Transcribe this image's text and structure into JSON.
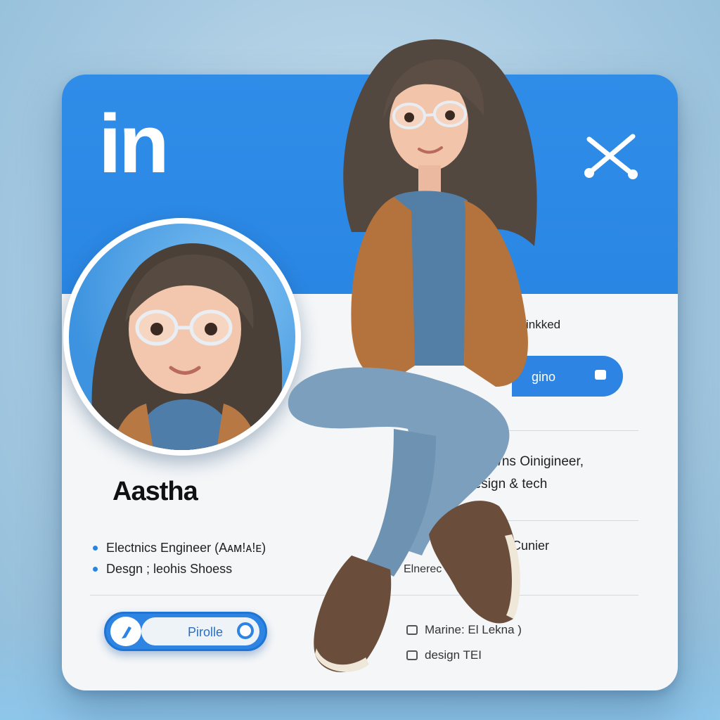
{
  "header": {
    "logo_text": "in",
    "accent_color": "#2f8de8"
  },
  "profile": {
    "name": "Aastha",
    "bullets": [
      "Electnics Engineer (Aᴀᴍ!ᴀ!ᴇ)",
      "Desgn ; leohis Shoess"
    ],
    "profile_button_label": "Pirolle"
  },
  "right_panel": {
    "linked_text": "inkked",
    "connect_button_label": "gino",
    "line1": "lelecti/ns Oinigineer,",
    "line2": "Design & tech",
    "line3": "Cunier",
    "line4": "Elnerec",
    "footer_items": [
      "Marine: El Lekna )",
      "design TEI"
    ]
  },
  "icons": {
    "close": "close-icon",
    "profile": "profile-pen-icon",
    "camera": "camera-icon"
  }
}
